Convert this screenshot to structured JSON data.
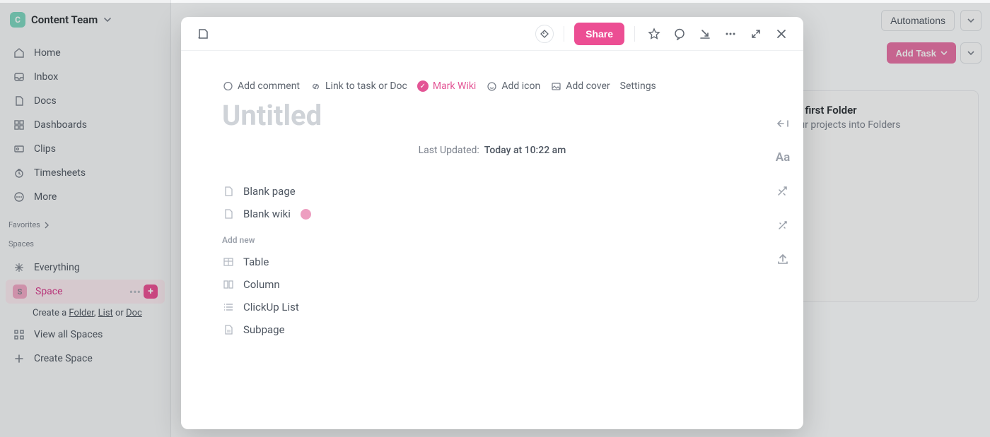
{
  "workspace": {
    "initial": "C",
    "name": "Content Team"
  },
  "nav": [
    {
      "label": "Home"
    },
    {
      "label": "Inbox"
    },
    {
      "label": "Docs"
    },
    {
      "label": "Dashboards"
    },
    {
      "label": "Clips"
    },
    {
      "label": "Timesheets"
    },
    {
      "label": "More"
    }
  ],
  "sections": {
    "favorites": "Favorites",
    "spaces": "Spaces"
  },
  "spaces": {
    "everything": "Everything",
    "active": {
      "initial": "S",
      "name": "Space"
    },
    "create_a": "Create a ",
    "link_folder": "Folder",
    "link_list": "List",
    "or": " or ",
    "link_doc": "Doc",
    "comma": ", ",
    "view_all": "View all Spaces",
    "create_space": "Create Space"
  },
  "header": {
    "automations": "Automations",
    "add_task": "Add Task"
  },
  "folder_card": {
    "title": "your first Folder",
    "subtitle": "e your projects into Folders"
  },
  "doc": {
    "share": "Share",
    "meta": {
      "add_comment": "Add comment",
      "link_task": "Link to task or Doc",
      "mark_wiki": "Mark Wiki",
      "add_icon": "Add icon",
      "add_cover": "Add cover",
      "settings": "Settings"
    },
    "title_placeholder": "Untitled",
    "updated_label": "Last Updated:",
    "updated_value": "Today at 10:22 am",
    "templates": {
      "blank_page": "Blank page",
      "blank_wiki": "Blank wiki",
      "add_new": "Add new",
      "table": "Table",
      "column": "Column",
      "clickup_list": "ClickUp List",
      "subpage": "Subpage"
    },
    "rail": {
      "aa": "Aa"
    }
  }
}
